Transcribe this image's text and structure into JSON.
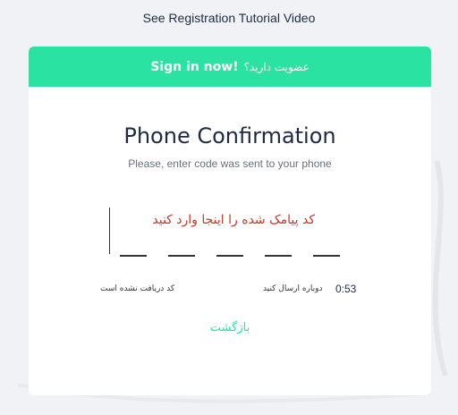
{
  "tutorial_link": "See Registration Tutorial Video",
  "banner": {
    "question": "عضویت دارید؟",
    "signin": "Sign in now!",
    "color": "#2ae2a2"
  },
  "title": "Phone Confirmation",
  "subtitle": "Please, enter code was sent to your phone",
  "code_hint": "کد پیامک شده را اینجا وارد کنید",
  "code_digits": [
    "",
    "",
    "",
    "",
    ""
  ],
  "no_code": "کد دریافت نشده است",
  "resend": "دوباره ارسال کنید",
  "timer": "0:53",
  "back": "بازگشت"
}
